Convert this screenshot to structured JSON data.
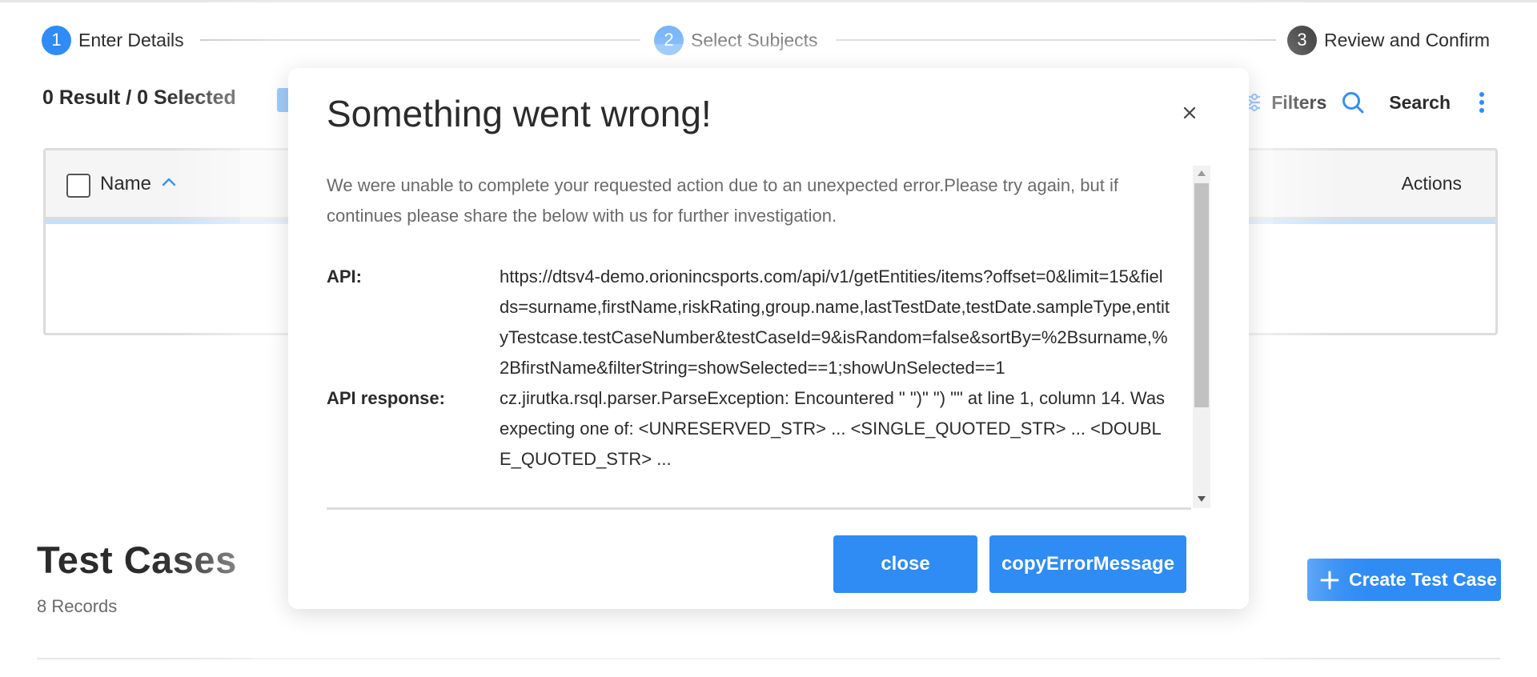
{
  "stepper": {
    "steps": [
      {
        "num": "1",
        "label": "Enter Details"
      },
      {
        "num": "2",
        "label": "Select Subjects"
      },
      {
        "num": "3",
        "label": "Review and Confirm"
      }
    ]
  },
  "selection": {
    "summary": "0 Result / 0 Selected"
  },
  "toolbar": {
    "filters_label": "Filters",
    "search_label": "Search"
  },
  "table": {
    "columns": {
      "name": "Name",
      "actions": "Actions"
    }
  },
  "test_cases": {
    "title": "Test Cases",
    "records": "8 Records",
    "create_label": "Create Test Case"
  },
  "modal": {
    "title": "Something went wrong!",
    "message": "We were unable to complete your requested action due to an unexpected error.Please try again, but if continues please share the below with us for further investigation.",
    "api_label": "API:",
    "api_value": "https://dtsv4-demo.orionincsports.com/api/v1/getEntities/items?offset=0&limit=15&fields=surname,firstName,riskRating,group.name,lastTestDate,testDate.sampleType,entityTestcase.testCaseNumber&testCaseId=9&isRandom=false&sortBy=%2Bsurname,%2BfirstName&filterString=showSelected==1;showUnSelected==1",
    "response_label": "API response:",
    "response_value": "cz.jirutka.rsql.parser.ParseException: Encountered \" \")\" \") \"\" at line 1, column 14. Was expecting one of: <UNRESERVED_STR> ... <SINGLE_QUOTED_STR> ... <DOUBLE_QUOTED_STR> ...",
    "close_label": "close",
    "copy_label": "copyErrorMessage"
  },
  "colors": {
    "accent": "#2f8cf4",
    "step_inactive": "#3a3a3a"
  }
}
